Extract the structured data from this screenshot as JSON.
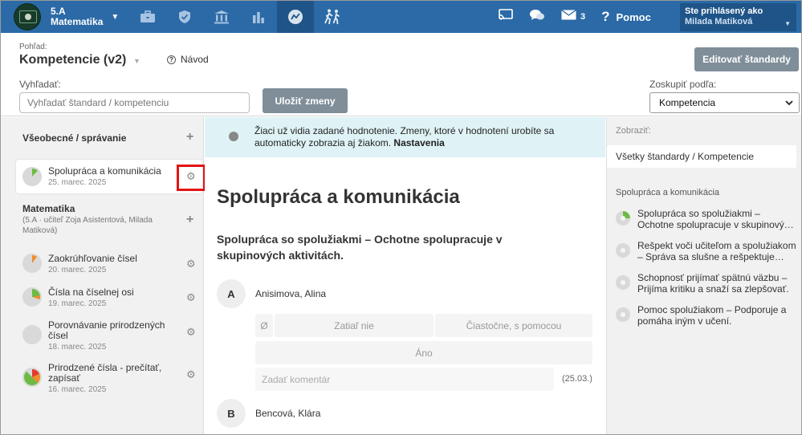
{
  "topbar": {
    "class_name": "5.A",
    "subject": "Matematika",
    "nav_icons": [
      "briefcase-icon",
      "shield-icon",
      "institution-icon",
      "bar-chart-icon",
      "competence-icon",
      "hiking-icon"
    ],
    "tools": [
      {
        "icon": "cast-icon",
        "count": ""
      },
      {
        "icon": "chat-icon",
        "count": ""
      },
      {
        "icon": "mail-icon",
        "count": "3"
      }
    ],
    "help_label": "Pomoc",
    "user_label": "Ste prihlásený ako",
    "user_name": "Milada Matiková"
  },
  "header": {
    "view_label": "Pohľad:",
    "view_title": "Kompetencie (v2)",
    "guide_label": "Návod",
    "edit_button": "Editovať štandardy",
    "search_label": "Vyhľadať:",
    "search_placeholder": "Vyhľadať štandard / kompetenciu",
    "save_button": "Uložiť zmeny",
    "group_label": "Zoskupiť podľa:",
    "group_value": "Kompetencia"
  },
  "sidebar": {
    "general_title": "Všeobecné / správanie",
    "general_items": [
      {
        "title": "Spolupráca a komunikácia",
        "date": "25. marec. 2025"
      }
    ],
    "math_title": "Matematika",
    "math_note": "(5.A · učiteľ Zoja Asistentová, Milada Matiková)",
    "math_items": [
      {
        "title": "Zaokrúhľovanie čísel",
        "date": "20. marec. 2025"
      },
      {
        "title": "Čísla na číselnej osi",
        "date": "19. marec. 2025"
      },
      {
        "title": "Porovnávanie prirodzených čísel",
        "date": "18. marec. 2025"
      },
      {
        "title": "Prirodzené čísla - prečítať, zapísať",
        "date": "16. marec. 2025"
      }
    ]
  },
  "main": {
    "notice_text": "Žiaci už vidia zadané hodnotenie. Zmeny, ktoré v hodnotení urobíte sa automaticky zobrazia aj žiakom.",
    "notice_link": "Nastavenia",
    "title": "Spolupráca a komunikácia",
    "standard": "Spolupráca so spolužiakmi – Ochotne spolupracuje v skupinových aktivitách.",
    "students": [
      {
        "initial": "A",
        "name": "Anisimova, Alina"
      },
      {
        "initial": "B",
        "name": "Bencová, Klára"
      }
    ],
    "option_zero": "Ø",
    "options": [
      "Zatiaľ nie",
      "Čiastočne, s pomocou",
      "Áno"
    ],
    "comment_placeholder": "Zadať komentár",
    "comment_date": "(25.03.)"
  },
  "right": {
    "show_label": "Zobraziť:",
    "show_value": "Všetky štandardy / Kompetencie",
    "section": "Spolupráca a komunikácia",
    "items": [
      "Spolupráca so spolužiakmi – Ochotne spolupracuje v skupinový…",
      "Rešpekt voči učiteľom a spolužiakom – Správa sa slušne a rešpektuje…",
      "Schopnosť prijímať spätnú väzbu – Prijíma kritiku a snaží sa zlepšovať.",
      "Pomoc spolužiakom – Podporuje a pomáha iným v učení."
    ]
  }
}
